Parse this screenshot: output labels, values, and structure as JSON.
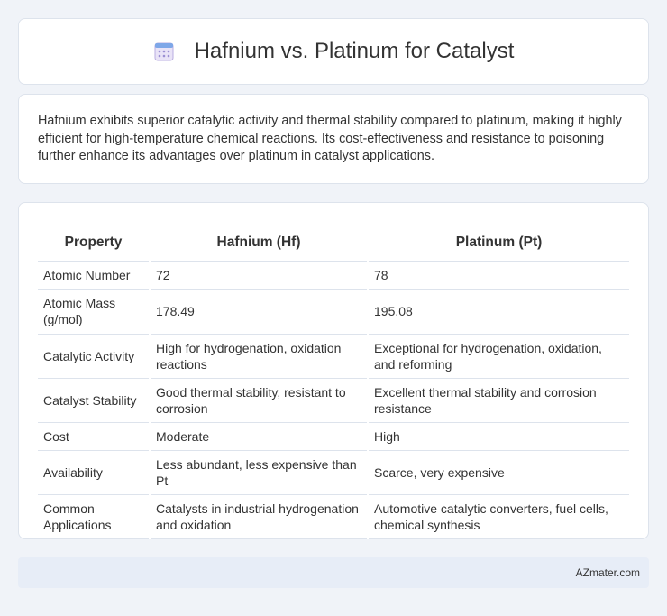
{
  "header": {
    "title": "Hafnium vs. Platinum for Catalyst",
    "icon": "calendar-icon"
  },
  "intro": {
    "text": "Hafnium exhibits superior catalytic activity and thermal stability compared to platinum, making it highly efficient for high-temperature chemical reactions. Its cost-effectiveness and resistance to poisoning further enhance its advantages over platinum in catalyst applications."
  },
  "table": {
    "headers": [
      "Property",
      "Hafnium (Hf)",
      "Platinum (Pt)"
    ],
    "rows": [
      [
        "Atomic Number",
        "72",
        "78"
      ],
      [
        "Atomic Mass (g/mol)",
        "178.49",
        "195.08"
      ],
      [
        "Catalytic Activity",
        "High for hydrogenation, oxidation reactions",
        "Exceptional for hydrogenation, oxidation, and reforming"
      ],
      [
        "Catalyst Stability",
        "Good thermal stability, resistant to corrosion",
        "Excellent thermal stability and corrosion resistance"
      ],
      [
        "Cost",
        "Moderate",
        "High"
      ],
      [
        "Availability",
        "Less abundant, less expensive than Pt",
        "Scarce, very expensive"
      ],
      [
        "Common Applications",
        "Catalysts in industrial hydrogenation and oxidation",
        "Automotive catalytic converters, fuel cells, chemical synthesis"
      ]
    ]
  },
  "footer": {
    "text": "AZmater.com"
  },
  "colors": {
    "background": "#f0f3f8",
    "card": "#ffffff",
    "footer_bg": "#e7edf7",
    "row_border": "#dde3ec"
  }
}
